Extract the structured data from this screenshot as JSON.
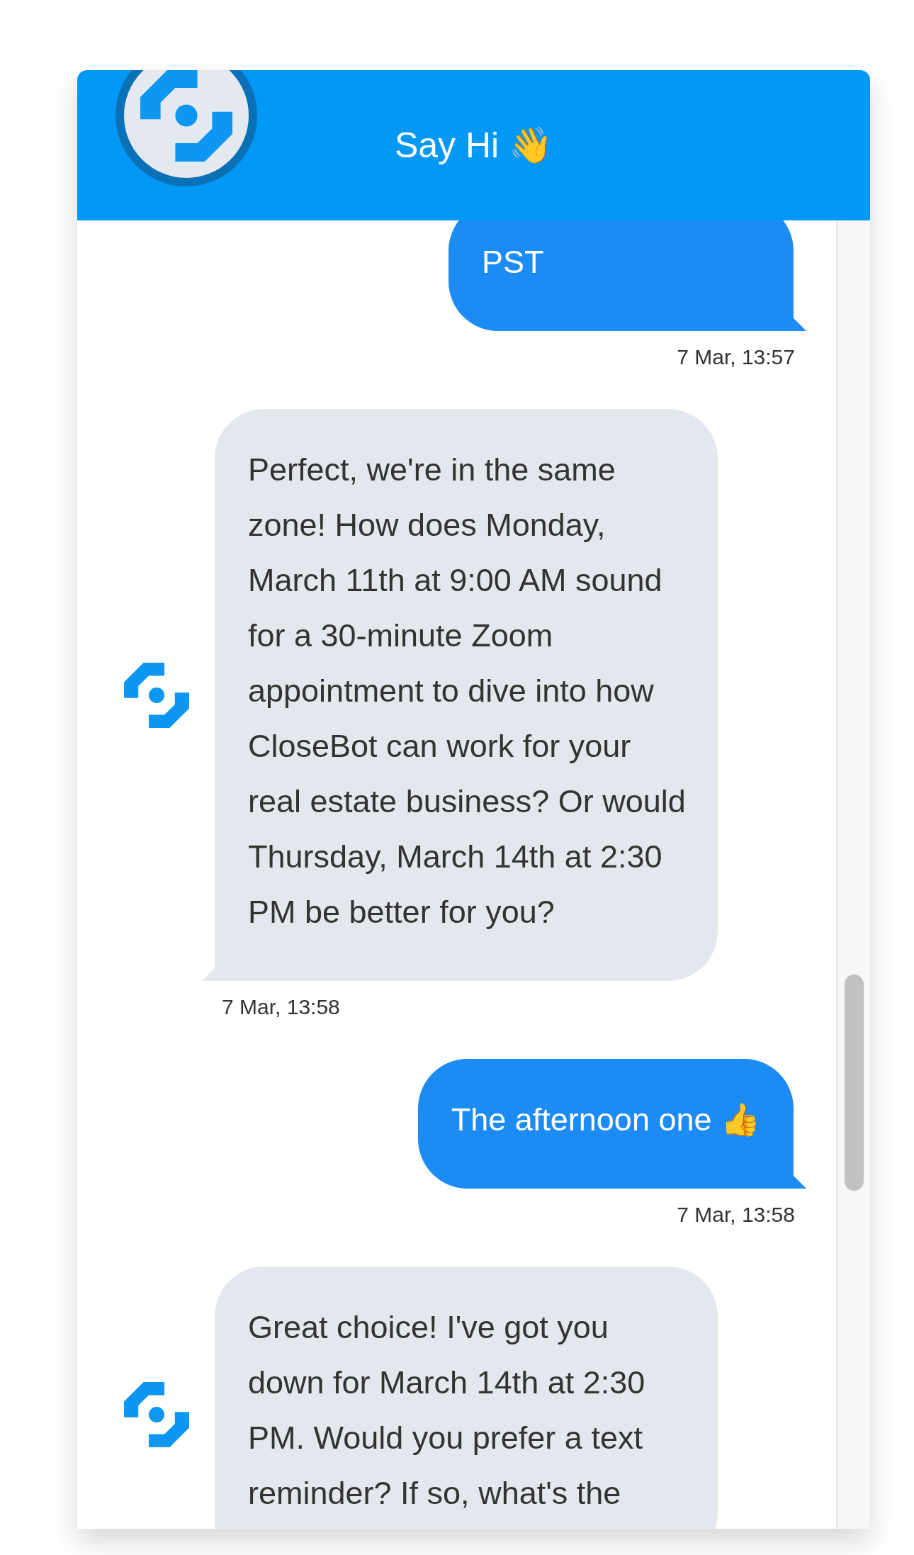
{
  "header": {
    "title": "Say Hi 👋"
  },
  "messages": [
    {
      "kind": "user",
      "text": "PST",
      "time": "7 Mar, 13:57"
    },
    {
      "kind": "bot",
      "text": "Perfect, we're in the same zone! How does Monday, March 11th at 9:00 AM sound for a 30-minute Zoom appointment to dive into how CloseBot can work for your real estate business? Or would Thursday, March 14th at 2:30 PM be better for you?",
      "time": "7 Mar, 13:58"
    },
    {
      "kind": "user",
      "text": "The afternoon one 👍",
      "time": "7 Mar, 13:58"
    },
    {
      "kind": "bot",
      "text": "Great choice! I've got you down for March 14th at 2:30 PM. Would you prefer a text reminder? If so, what's the"
    }
  ]
}
